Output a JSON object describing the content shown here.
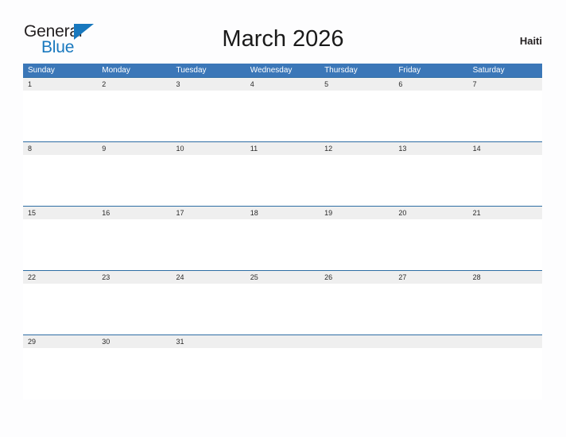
{
  "logo": {
    "word_one": "General",
    "word_two": "Blue",
    "flag_icon": "blue-triangle-flag",
    "color_dark": "#231f20",
    "color_blue": "#1878be"
  },
  "header": {
    "title": "March 2026",
    "month": "March",
    "year": "2026",
    "locale": "Haiti"
  },
  "calendar": {
    "accent_color": "#3b77b8",
    "row_line_color": "#2e6da4",
    "date_band_color": "#efefef",
    "weekdays": [
      "Sunday",
      "Monday",
      "Tuesday",
      "Wednesday",
      "Thursday",
      "Friday",
      "Saturday"
    ],
    "weeks": [
      [
        "1",
        "2",
        "3",
        "4",
        "5",
        "6",
        "7"
      ],
      [
        "8",
        "9",
        "10",
        "11",
        "12",
        "13",
        "14"
      ],
      [
        "15",
        "16",
        "17",
        "18",
        "19",
        "20",
        "21"
      ],
      [
        "22",
        "23",
        "24",
        "25",
        "26",
        "27",
        "28"
      ],
      [
        "29",
        "30",
        "31",
        "",
        "",
        "",
        ""
      ]
    ]
  }
}
